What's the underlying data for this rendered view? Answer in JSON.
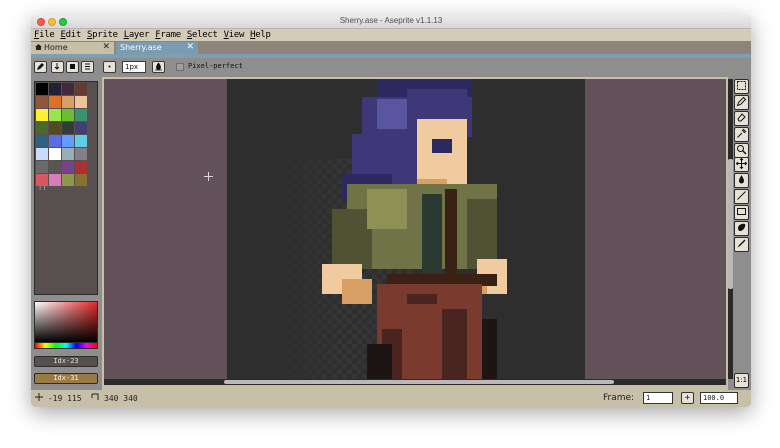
{
  "window": {
    "title": "Sherry.ase - Aseprite v1.1.13"
  },
  "menu": [
    "File",
    "Edit",
    "Sprite",
    "Layer",
    "Frame",
    "Select",
    "View",
    "Help"
  ],
  "tabs": [
    {
      "label": "Home",
      "icon": "home-icon",
      "close": "✕"
    },
    {
      "label": "Sherry.ase",
      "close": "✕"
    }
  ],
  "toolbar": {
    "brush_size": "1px",
    "pixel_perfect_label": "Pixel-perfect",
    "buttons": [
      "pencil-icon",
      "arrow-down-icon",
      "square-icon",
      "lines-icon",
      "dot-icon"
    ]
  },
  "palette": {
    "colors": [
      "#000000",
      "#222034",
      "#45283c",
      "#663931",
      "#8f563b",
      "#df7126",
      "#d9a066",
      "#eec39a",
      "#fbf236",
      "#99e550",
      "#6abe30",
      "#37946e",
      "#4b692f",
      "#524b24",
      "#323c39",
      "#3f3f74",
      "#306082",
      "#5b6ee1",
      "#639bff",
      "#5fcde4",
      "#cbdbfc",
      "#ffffff",
      "#9badb7",
      "#847e87",
      "#696a6a",
      "#595652",
      "#76428a",
      "#ac3232",
      "#d95763",
      "#d77bba",
      "#8f974a",
      "#8a6f30"
    ],
    "indicator": "!!"
  },
  "color_indices": {
    "fg": "Idx-23",
    "bg": "Idx-31"
  },
  "status": {
    "position": "-19 115",
    "size": "340 340",
    "frame_label": "Frame:",
    "frame_value": "1",
    "plus": "+",
    "zoom": "100.0"
  },
  "tools": [
    "marquee-icon",
    "pencil-icon",
    "eraser-icon",
    "eyedropper-icon",
    "zoom-icon",
    "move-icon",
    "bucket-icon",
    "line-icon",
    "rectangle-icon",
    "blur-icon",
    "brush-icon"
  ],
  "zoom_button": "1:1",
  "sprite_colors": {
    "hair_dark": "#2c2860",
    "hair": "#3e3878",
    "hair_light": "#5a55a0",
    "skin": "#f1cba0",
    "skin_shade": "#d9a066",
    "jacket": "#6f7345",
    "jacket_dark": "#4f5233",
    "jacket_light": "#8e9155",
    "shirt": "#2a3a33",
    "strap": "#3b2114",
    "pants": "#7a3a2e",
    "pants_dark": "#4a2420",
    "outline": "#1d1414"
  }
}
